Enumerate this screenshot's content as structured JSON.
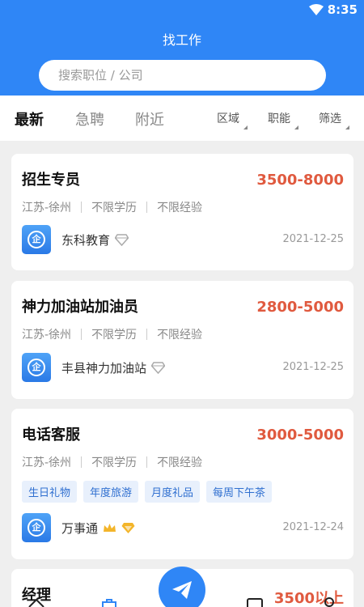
{
  "status": {
    "time": "8:35"
  },
  "header": {
    "title": "找工作",
    "search_placeholder": "搜索职位 / 公司"
  },
  "tabs": [
    {
      "label": "最新",
      "active": true
    },
    {
      "label": "急聘",
      "active": false
    },
    {
      "label": "附近",
      "active": false
    }
  ],
  "filters": [
    "区域",
    "职能",
    "筛选"
  ],
  "jobs": [
    {
      "title": "招生专员",
      "salary": "3500-8000",
      "location": "江苏-徐州",
      "education": "不限学历",
      "experience": "不限经验",
      "company": "东科教育",
      "date": "2021-12-25",
      "tags": []
    },
    {
      "title": "神力加油站加油员",
      "salary": "2800-5000",
      "location": "江苏-徐州",
      "education": "不限学历",
      "experience": "不限经验",
      "company": "丰县神力加油站",
      "date": "2021-12-25",
      "tags": []
    },
    {
      "title": "电话客服",
      "salary": "3000-5000",
      "location": "江苏-徐州",
      "education": "不限学历",
      "experience": "不限经验",
      "company": "万事通",
      "date": "2021-12-24",
      "tags": [
        "生日礼物",
        "年度旅游",
        "月度礼品",
        "每周下午茶"
      ]
    },
    {
      "title": "经理",
      "salary": "3500以上"
    }
  ],
  "colors": {
    "primary": "#2f86f6",
    "salary": "#e05a3f"
  },
  "logo_char": "企"
}
